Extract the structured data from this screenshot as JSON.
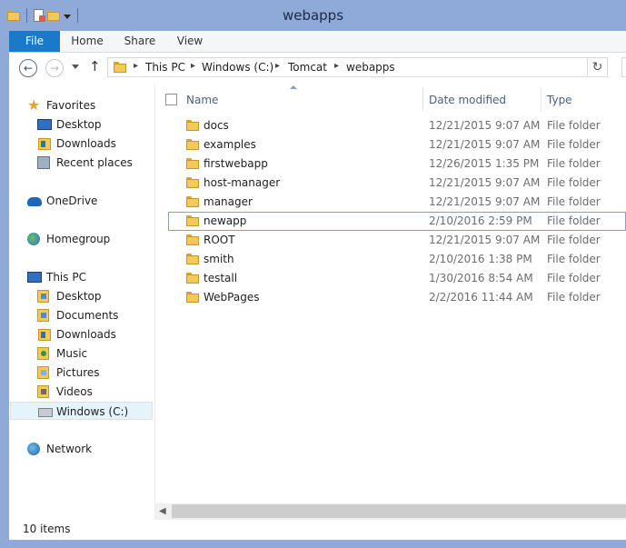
{
  "window": {
    "title": "webapps"
  },
  "ribbon": {
    "tabs": [
      "File",
      "Home",
      "Share",
      "View"
    ]
  },
  "address": {
    "crumbs": [
      "This PC",
      "Windows (C:)",
      "Tomcat",
      "webapps"
    ]
  },
  "nav": {
    "favorites": {
      "label": "Favorites",
      "items": [
        "Desktop",
        "Downloads",
        "Recent places"
      ]
    },
    "onedrive": "OneDrive",
    "homegroup": "Homegroup",
    "thispc": {
      "label": "This PC",
      "items": [
        "Desktop",
        "Documents",
        "Downloads",
        "Music",
        "Pictures",
        "Videos",
        "Windows (C:)"
      ]
    },
    "network": "Network"
  },
  "columns": {
    "name": "Name",
    "date": "Date modified",
    "type": "Type"
  },
  "files": [
    {
      "name": "docs",
      "date": "12/21/2015 9:07 AM",
      "type": "File folder"
    },
    {
      "name": "examples",
      "date": "12/21/2015 9:07 AM",
      "type": "File folder"
    },
    {
      "name": "firstwebapp",
      "date": "12/26/2015 1:35 PM",
      "type": "File folder"
    },
    {
      "name": "host-manager",
      "date": "12/21/2015 9:07 AM",
      "type": "File folder"
    },
    {
      "name": "manager",
      "date": "12/21/2015 9:07 AM",
      "type": "File folder"
    },
    {
      "name": "newapp",
      "date": "2/10/2016 2:59 PM",
      "type": "File folder"
    },
    {
      "name": "ROOT",
      "date": "12/21/2015 9:07 AM",
      "type": "File folder"
    },
    {
      "name": "smith",
      "date": "2/10/2016 1:38 PM",
      "type": "File folder"
    },
    {
      "name": "testall",
      "date": "1/30/2016 8:54 AM",
      "type": "File folder"
    },
    {
      "name": "WebPages",
      "date": "2/2/2016 11:44 AM",
      "type": "File folder"
    }
  ],
  "status": {
    "count": "10 items"
  },
  "colors": {
    "frame": "#8fa9d8",
    "file_tab": "#1979ca",
    "folder": "#f3c95a",
    "selection_border": "#7da2ce"
  }
}
